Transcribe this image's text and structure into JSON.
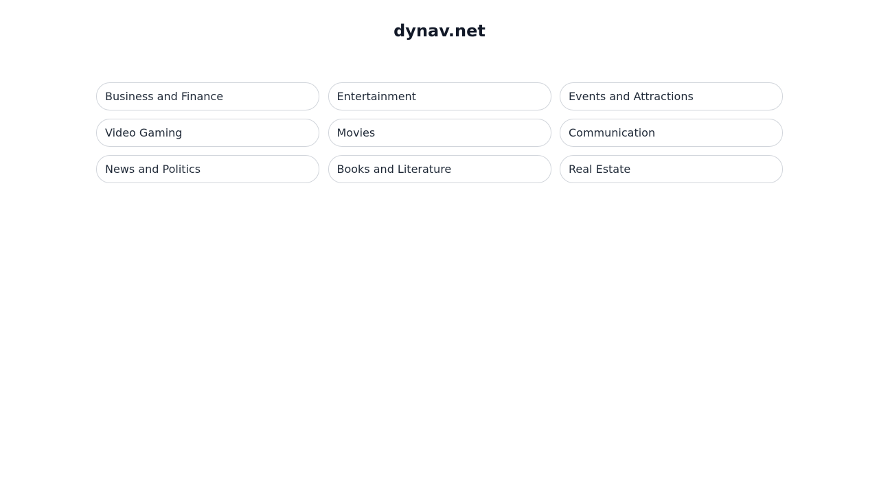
{
  "site": {
    "title": "dynav.net"
  },
  "categories": [
    {
      "label": "Business and Finance"
    },
    {
      "label": "Entertainment"
    },
    {
      "label": "Events and Attractions"
    },
    {
      "label": "Video Gaming"
    },
    {
      "label": "Movies"
    },
    {
      "label": "Communication"
    },
    {
      "label": "News and Politics"
    },
    {
      "label": "Books and Literature"
    },
    {
      "label": "Real Estate"
    }
  ],
  "colors": {
    "title": "#111827",
    "text": "#1f2937",
    "border": "#d1d5db",
    "background": "#ffffff"
  }
}
